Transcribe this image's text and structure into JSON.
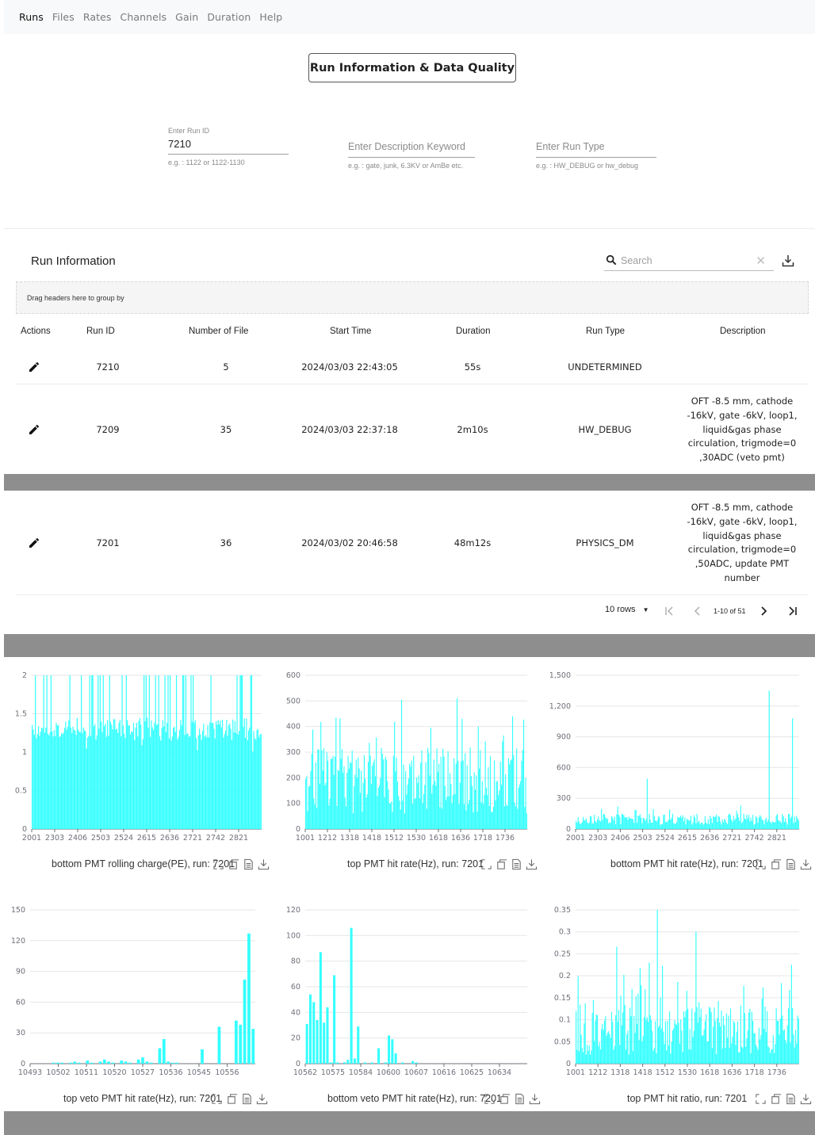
{
  "nav": {
    "items": [
      "Runs",
      "Files",
      "Rates",
      "Channels",
      "Gain",
      "Duration",
      "Help"
    ],
    "active": "Runs"
  },
  "page_title": "Run Information & Data Quality",
  "filters": {
    "run_id": {
      "label": "Enter Run ID",
      "value": "7210",
      "help": "e.g. : 1122 or 1122-1130"
    },
    "description": {
      "placeholder": "Enter Description Keyword",
      "help": "e.g. : gate, junk, 6.3KV or AmBe etc."
    },
    "run_type": {
      "placeholder": "Enter Run Type",
      "help": "e.g. : HW_DEBUG or hw_debug"
    }
  },
  "table": {
    "title": "Run Information",
    "search_placeholder": "Search",
    "group_by_hint": "Drag headers here to group by",
    "columns": [
      "Actions",
      "Run ID",
      "Number of File",
      "Start Time",
      "Duration",
      "Run Type",
      "Description"
    ],
    "rows": [
      {
        "run_id": "7210",
        "files": "5",
        "start": "2024/03/03 22:43:05",
        "duration": "55s",
        "type": "UNDETERMINED",
        "desc": []
      },
      {
        "run_id": "7209",
        "files": "35",
        "start": "2024/03/03 22:37:18",
        "duration": "2m10s",
        "type": "HW_DEBUG",
        "desc": [
          "OFT -8.5 mm, cathode",
          "-16kV, gate -6kV, loop1,",
          "liquid&gas phase",
          "circulation, trigmode=0",
          ",30ADC (veto pmt)"
        ]
      },
      {
        "run_id": "7201",
        "files": "36",
        "start": "2024/03/02 20:46:58",
        "duration": "48m12s",
        "type": "PHYSICS_DM",
        "desc": [
          "OFT -8.5 mm, cathode",
          "-16kV, gate -6kV, loop1,",
          "liquid&gas phase",
          "circulation, trigmode=0",
          ",50ADC, update PMT",
          "number"
        ]
      }
    ],
    "pagination": {
      "rows_per_page": "10 rows",
      "range": "1-10 of 51"
    }
  },
  "colors": {
    "bar": "#33ffff",
    "grid": "#e6e6e6",
    "band": "#8e8e8e"
  },
  "chart_data": [
    {
      "type": "bar",
      "title": "bottom PMT rolling charge(PE), run: 7201",
      "ylim": [
        0,
        2
      ],
      "yticks": [
        "0",
        "0.5",
        "1",
        "1.5",
        "2"
      ],
      "xticks": [
        "2001",
        "2303",
        "2406",
        "2503",
        "2524",
        "2615",
        "2636",
        "2721",
        "2742",
        "2821"
      ],
      "n_bars": 220,
      "values_summary": {
        "typical": 1.3,
        "saturated_at": 2
      }
    },
    {
      "type": "bar",
      "title": "top PMT hit rate(Hz), run: 7201",
      "ylim": [
        0,
        600
      ],
      "yticks": [
        "0",
        "100",
        "200",
        "300",
        "400",
        "500",
        "600"
      ],
      "xticks": [
        "1001",
        "1212",
        "1318",
        "1418",
        "1512",
        "1530",
        "1618",
        "1636",
        "1718",
        "1736"
      ],
      "n_bars": 220,
      "values_summary": {
        "typical": 180,
        "max": 510
      }
    },
    {
      "type": "bar",
      "title": "bottom PMT hit rate(Hz), run: 7201",
      "ylim": [
        0,
        1500
      ],
      "yticks": [
        "0",
        "300",
        "600",
        "900",
        "1,200",
        "1,500"
      ],
      "xticks": [
        "2001",
        "2303",
        "2406",
        "2503",
        "2524",
        "2615",
        "2636",
        "2721",
        "2742",
        "2821"
      ],
      "n_bars": 220,
      "values_summary": {
        "typical": 100,
        "max": 1350
      }
    },
    {
      "type": "bar",
      "title": "top veto PMT hit rate(Hz), run: 7201",
      "ylim": [
        0,
        150
      ],
      "yticks": [
        "0",
        "30",
        "60",
        "90",
        "120",
        "150"
      ],
      "xticks": [
        "10493",
        "10502",
        "10511",
        "10520",
        "10527",
        "10536",
        "10545",
        "10556"
      ],
      "values": [
        0,
        0,
        0,
        0,
        0,
        1,
        1,
        1,
        0,
        1,
        2,
        1,
        0,
        3,
        1,
        0,
        2,
        4,
        2,
        1,
        0,
        3,
        2,
        1,
        0,
        4,
        6,
        2,
        1,
        0,
        15,
        24,
        2,
        1,
        1,
        0,
        0,
        0,
        0,
        0,
        14,
        0,
        0,
        0,
        36,
        0,
        0,
        0,
        42,
        38,
        82,
        127,
        34
      ]
    },
    {
      "type": "bar",
      "title": "bottom veto PMT hit rate(Hz), run: 7201",
      "ylim": [
        0,
        120
      ],
      "yticks": [
        "0",
        "20",
        "40",
        "60",
        "80",
        "100",
        "120"
      ],
      "xticks": [
        "10562",
        "10575",
        "10584",
        "10600",
        "10607",
        "10616",
        "10625",
        "10634"
      ],
      "values": [
        31,
        54,
        48,
        34,
        87,
        32,
        44,
        1,
        69,
        1,
        0,
        1,
        3,
        106,
        4,
        29,
        0,
        1,
        0,
        1,
        0,
        12,
        0,
        1,
        22,
        19,
        8,
        0,
        1,
        0,
        0,
        2,
        1,
        0,
        0,
        0,
        0,
        0,
        0,
        0,
        0,
        0,
        0,
        0,
        0,
        0,
        0,
        0,
        0,
        0,
        0,
        0,
        0,
        0,
        0,
        0,
        0,
        0,
        0,
        0,
        0,
        0,
        0,
        0,
        0
      ]
    },
    {
      "type": "bar",
      "title": "top PMT hit ratio, run: 7201",
      "ylim": [
        0,
        0.35
      ],
      "yticks": [
        "0",
        "0.05",
        "0.1",
        "0.15",
        "0.2",
        "0.25",
        "0.3",
        "0.35"
      ],
      "xticks": [
        "1001",
        "1212",
        "1318",
        "1418",
        "1512",
        "1530",
        "1618",
        "1636",
        "1718",
        "1736"
      ],
      "n_bars": 220,
      "values_summary": {
        "typical": 0.07,
        "max": 0.35
      }
    }
  ]
}
